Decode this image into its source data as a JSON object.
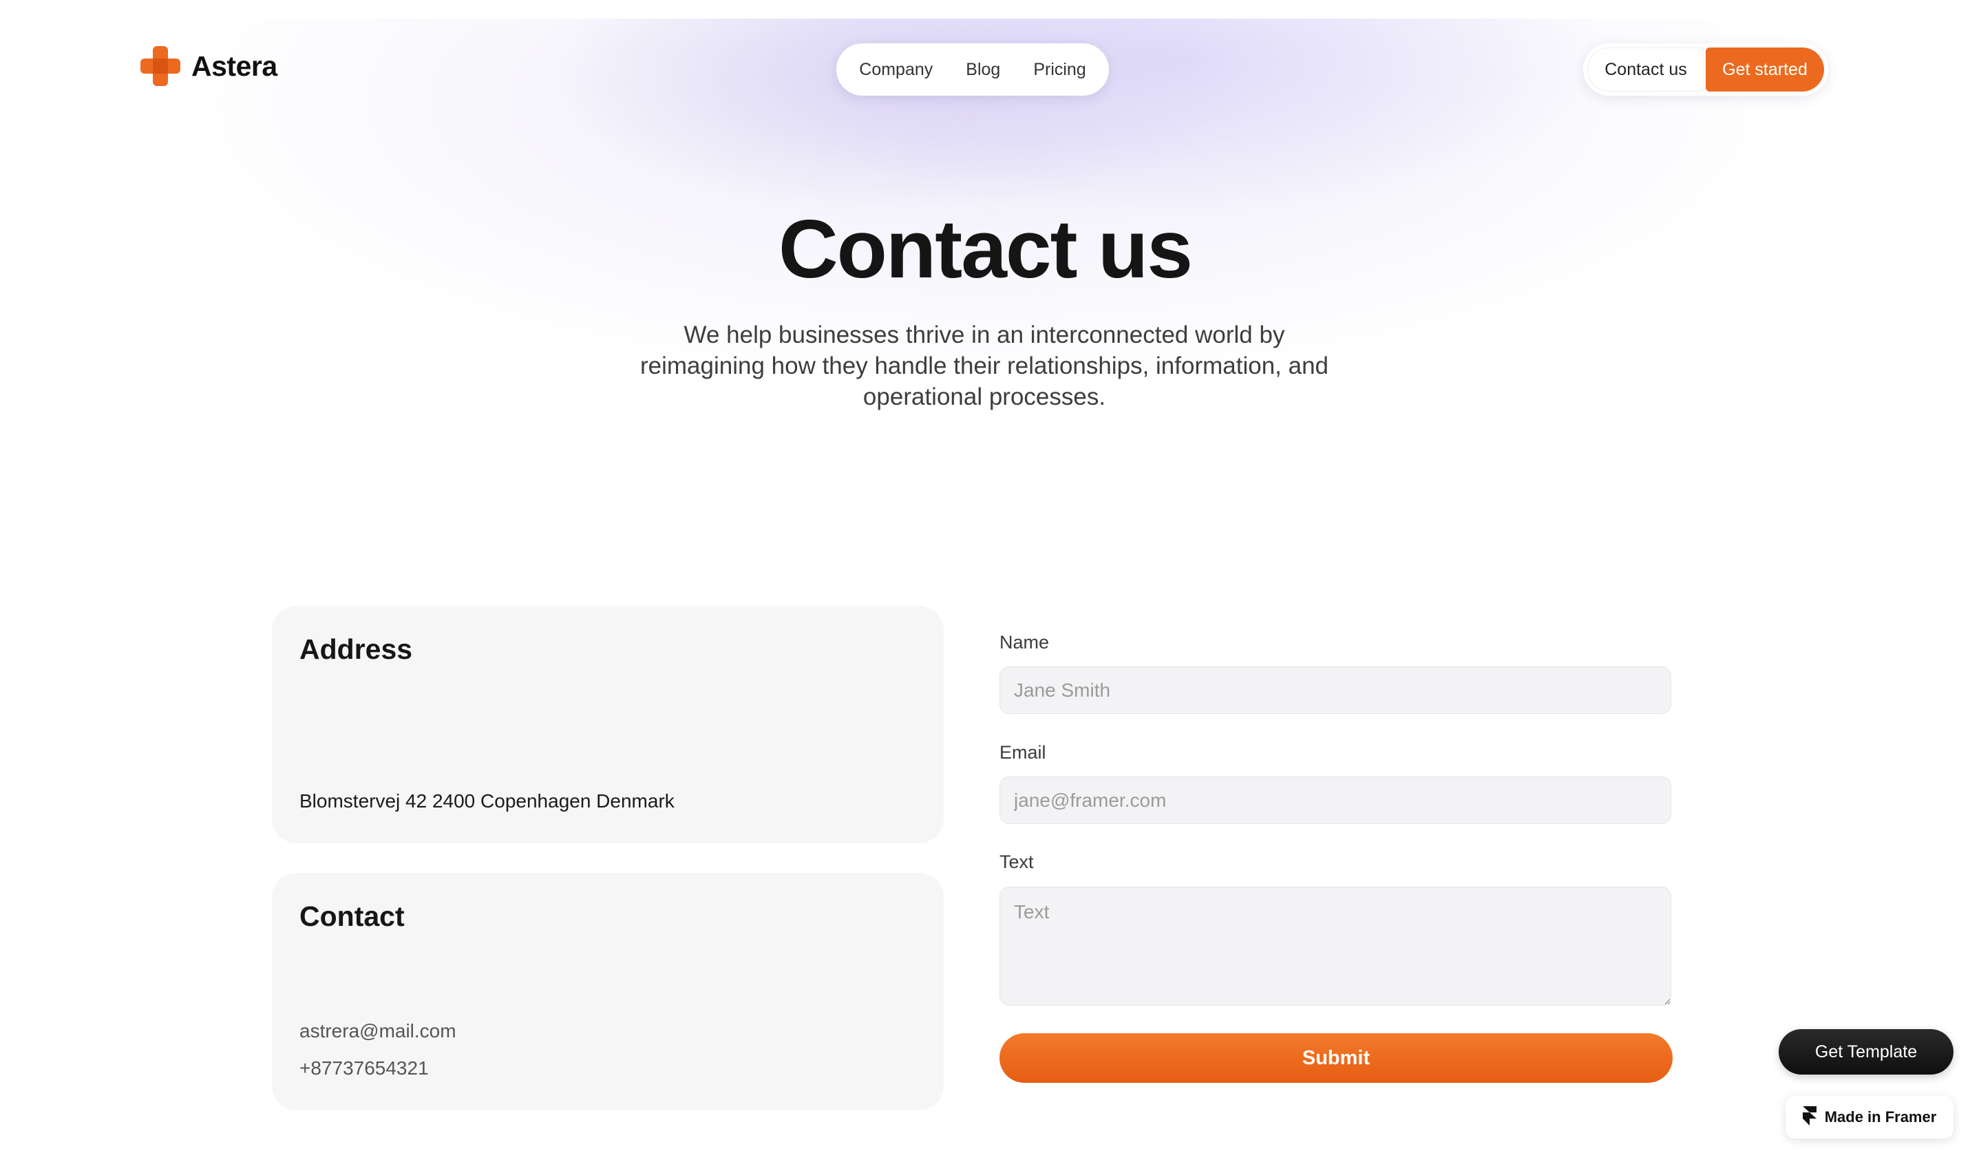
{
  "brand": {
    "name": "Astera",
    "accent_color": "#ec6a20",
    "logo_icon": "plus-cross-logo-icon"
  },
  "nav": {
    "links": [
      "Company",
      "Blog",
      "Pricing"
    ],
    "contact_label": "Contact us",
    "get_started_label": "Get started"
  },
  "hero": {
    "title": "Contact us",
    "subtitle": "We help businesses thrive in an interconnected world by reimagining how they handle their relationships, information, and operational processes."
  },
  "address_card": {
    "title": "Address",
    "address": "Blomstervej 42 2400 Copenhagen Denmark"
  },
  "contact_card": {
    "title": "Contact",
    "email": "astrera@mail.com",
    "phone": "+87737654321"
  },
  "form": {
    "name_label": "Name",
    "name_placeholder": "Jane Smith",
    "email_label": "Email",
    "email_placeholder": "jane@framer.com",
    "text_label": "Text",
    "text_placeholder": "Text",
    "submit_label": "Submit"
  },
  "badges": {
    "get_template_label": "Get Template",
    "made_in_framer_label": "Made in Framer",
    "framer_icon": "framer-logo-icon"
  }
}
